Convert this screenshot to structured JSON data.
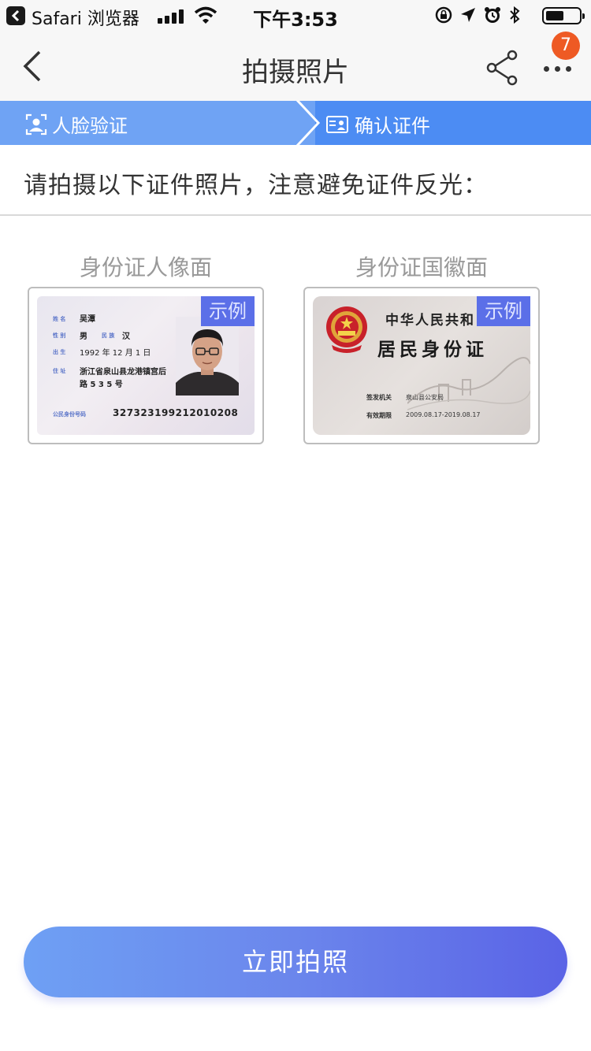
{
  "status_bar": {
    "app_name": "Safari 浏览器",
    "time": "下午3:53"
  },
  "nav": {
    "title": "拍摄照片",
    "badge_count": "7"
  },
  "steps": [
    {
      "label": "人脸验证",
      "icon": "face-scan-icon"
    },
    {
      "label": "确认证件",
      "icon": "id-card-icon"
    }
  ],
  "instruction": "请拍摄以下证件照片，注意避免证件反光：",
  "cards": [
    {
      "label": "身份证人像面",
      "badge": "示例",
      "fields": {
        "name_label": "姓 名",
        "name": "吴潭",
        "sex_label": "性 别",
        "sex": "男",
        "ethnic_label": "民 族",
        "ethnic": "汉",
        "birth_label": "出 生",
        "birth": "1992 年 12 月 1 日",
        "addr_label": "住 址",
        "addr1": "浙江省泉山县龙港镇宫后",
        "addr2": "路 5 3 5 号",
        "id_label": "公民身份号码",
        "id_number": "327323199212010208"
      }
    },
    {
      "label": "身份证国徽面",
      "badge": "示例",
      "fields": {
        "country": "中华人民共和",
        "card_name": "居民身份证",
        "authority_label": "签发机关",
        "authority": "泉山县公安局",
        "validity_label": "有效期限",
        "validity": "2009.08.17-2019.08.17"
      }
    }
  ],
  "button": {
    "label": "立即拍照"
  },
  "colors": {
    "accent": "#4c8cf3",
    "step_inactive": "#6fa3f4",
    "badge": "#5b6fe8",
    "notification": "#ee5a24"
  }
}
